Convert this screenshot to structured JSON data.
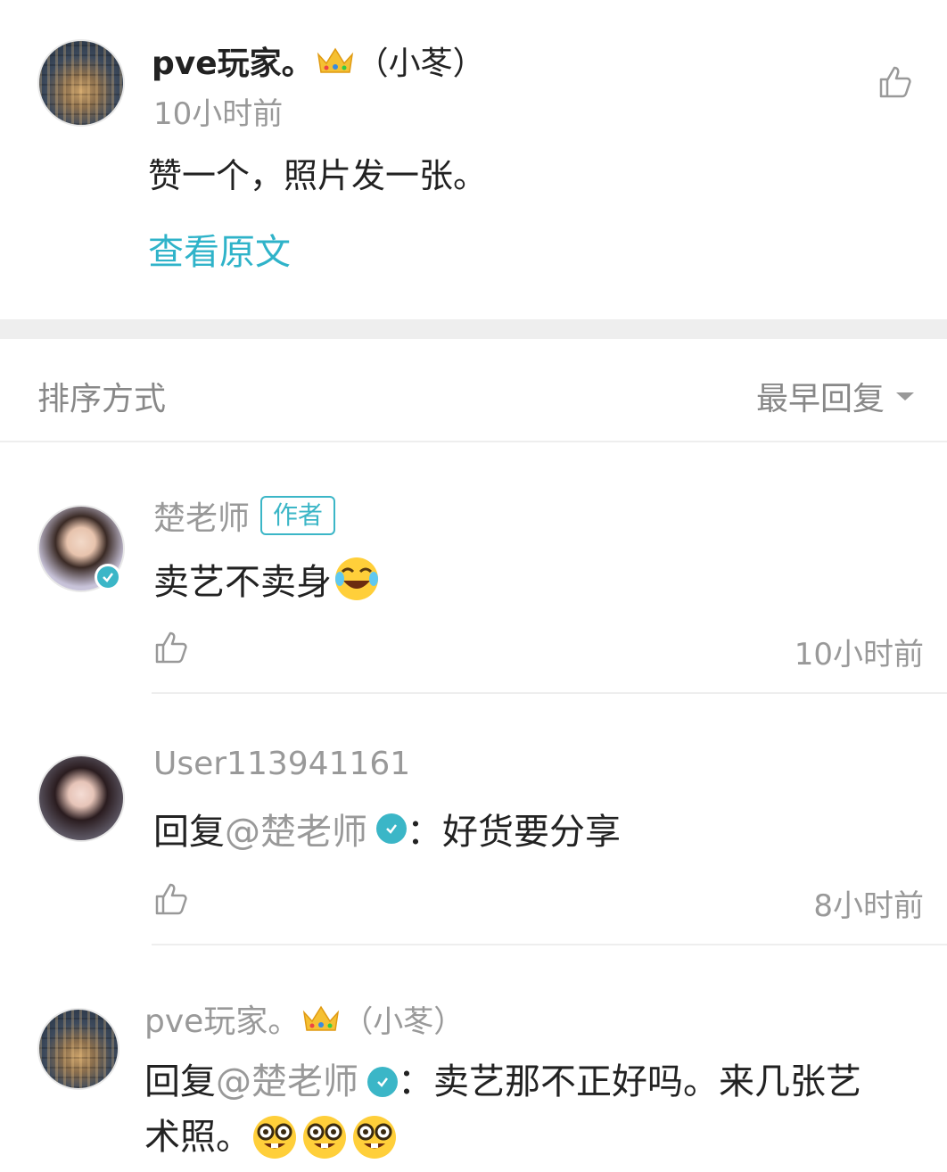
{
  "post": {
    "author": "pve玩家。",
    "author_badge": "（小苳）",
    "time": "10小时前",
    "text": "赞一个，照片发一张。",
    "view_original": "查看原文"
  },
  "sort_bar": {
    "label": "排序方式",
    "value": "最早回复"
  },
  "comments": [
    {
      "username": "楚老师",
      "tag": "作者",
      "text": "卖艺不卖身",
      "time": "10小时前"
    },
    {
      "username": "User113941161",
      "reply_prefix": "回复",
      "mention": "@楚老师",
      "colon": "：",
      "text": "好货要分享",
      "time": "8小时前"
    },
    {
      "username": "pve玩家。",
      "badge": "（小苳）",
      "reply_prefix": "回复",
      "mention": "@楚老师",
      "colon": "：",
      "text_line1": "卖艺那不正好吗。来几张艺",
      "text_line2": "术照。"
    }
  ],
  "colors": {
    "accent": "#2fb3c9",
    "verified": "#3bb6c7",
    "gray_text": "#999999",
    "divider": "#eeeeee"
  },
  "icons": [
    "thumbs-up-icon",
    "crown-icon",
    "verified-icon",
    "caret-down-icon",
    "laughing-emoji-icon",
    "nerd-emoji-icon"
  ]
}
